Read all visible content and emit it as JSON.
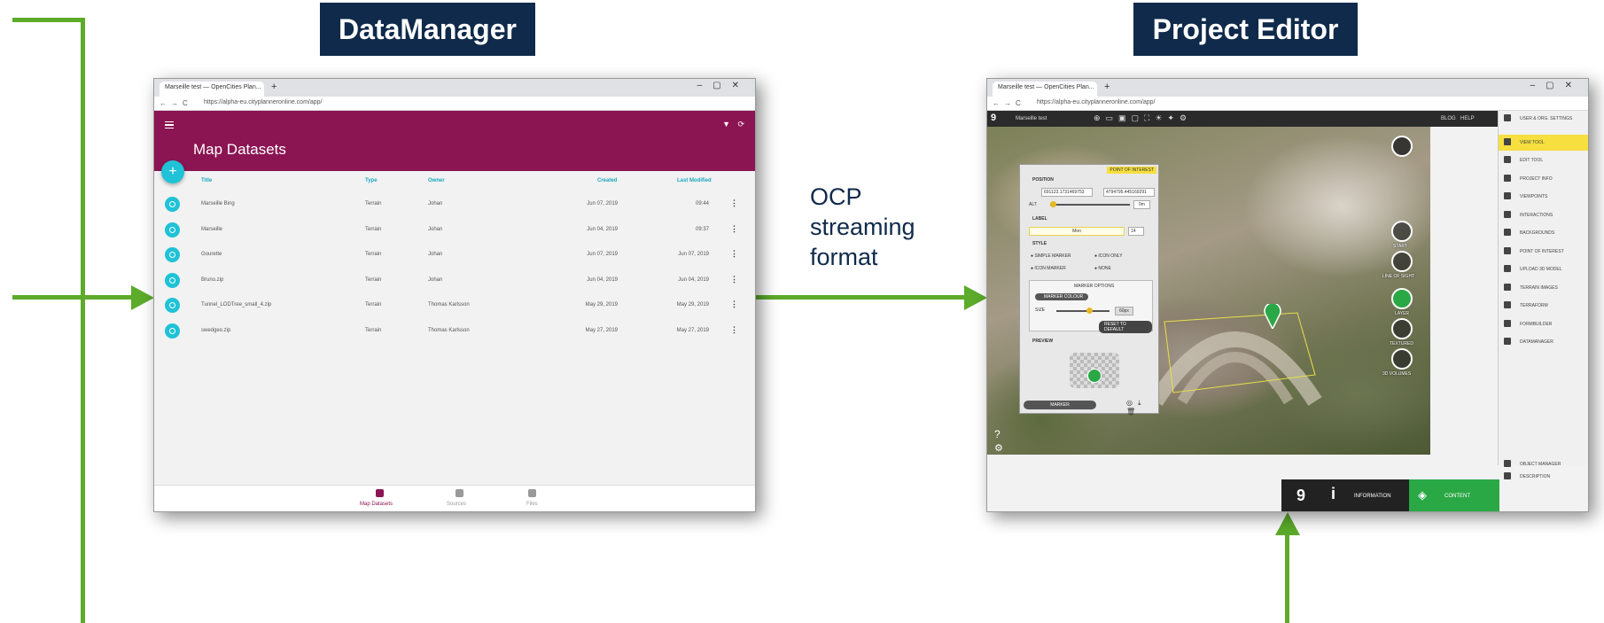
{
  "titles": {
    "left": "DataManager",
    "right": "Project Editor"
  },
  "arrow_label": [
    "OCP",
    "streaming",
    "format"
  ],
  "colors": {
    "title_bg": "#0f2a4a",
    "arrow": "#5cab2a",
    "dm_header": "#8b1452",
    "dm_accent": "#1fc2d6",
    "pe_active": "#f6df3e",
    "pe_content": "#2aa845"
  },
  "datamanager": {
    "tab_title": "Marseille test — OpenCities Plan...",
    "url": "https://alpha-eu.cityplanneronline.com/app/",
    "page_title": "Map Datasets",
    "fab": "+",
    "columns": [
      "Title",
      "Type",
      "Owner",
      "Created",
      "Last Modified"
    ],
    "rows": [
      {
        "title": "Marseille Bing",
        "type": "Terrain",
        "owner": "Johan",
        "created": "Jun 07, 2019",
        "modified": "09:44"
      },
      {
        "title": "Marseille",
        "type": "Terrain",
        "owner": "Johan",
        "created": "Jun 04, 2019",
        "modified": "09:37"
      },
      {
        "title": "Gourette",
        "type": "Terrain",
        "owner": "Johan",
        "created": "Jun 07, 2019",
        "modified": "Jun 07, 2019"
      },
      {
        "title": "Bruno.zip",
        "type": "Terrain",
        "owner": "Johan",
        "created": "Jun 04, 2019",
        "modified": "Jun 04, 2019"
      },
      {
        "title": "Tunnel_LODTree_small_4.zip",
        "type": "Terrain",
        "owner": "Thomas Karlsson",
        "created": "May 29, 2019",
        "modified": "May 29, 2019"
      },
      {
        "title": "swedgeo.zip",
        "type": "Terrain",
        "owner": "Thomas Karlsson",
        "created": "May 27, 2019",
        "modified": "May 27, 2019"
      }
    ],
    "footer": [
      "Map Datasets",
      "Sources",
      "Files"
    ]
  },
  "editor": {
    "tab_title": "Marseille test — OpenCities Plan...",
    "url": "https://alpha-eu.cityplanneronline.com/app/",
    "project_name": "Marseille test",
    "toolbar_right": [
      "BLOG",
      "HELP"
    ],
    "side_items": [
      "USER & ORG. SETTINGS",
      "VIEW TOOL",
      "EDIT TOOL",
      "PROJECT INFO",
      "VIEWPOINTS",
      "INTERACTIONS",
      "BACKGROUNDS",
      "POINT OF INTEREST",
      "UPLOAD 3D MODEL",
      "TERRAIN IMAGES",
      "TERRAFORM",
      "FORMBUILDER",
      "DATAMANAGER"
    ],
    "side_bottom": [
      "OBJECT MANAGER",
      "DESCRIPTION"
    ],
    "poi_panel": {
      "header": "POINT OF INTEREST",
      "position": "POSITION",
      "coord_x": "691123.1731469753",
      "coord_y": "4794795.445169291",
      "alt": "ALT",
      "alt_value": "0m",
      "label": "LABEL",
      "label_value": "Mon",
      "label_size": "14",
      "style": "STYLE",
      "style_opts": [
        "SIMPLE MARKER",
        "ICON ONLY",
        "ICON MARKER",
        "NONE"
      ],
      "marker_options": "MARKER OPTIONS",
      "marker_colour": "MARKER COLOUR",
      "size": "SIZE",
      "size_value": "60px",
      "reset": "RESET TO DEFAULT",
      "preview": "PREVIEW",
      "marker_btn": "MARKER"
    },
    "map_buttons": [
      "START",
      "LINE OF SIGHT",
      "LAYER",
      "TEXTURED",
      "3D VOLUMES"
    ],
    "bottom": {
      "info": "INFORMATION",
      "content": "CONTENT"
    }
  }
}
